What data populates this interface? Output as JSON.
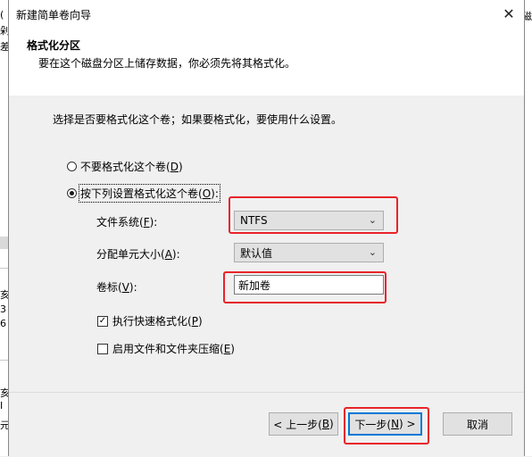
{
  "window": {
    "title": "新建简单卷向导",
    "close_glyph": "✕"
  },
  "header": {
    "title": "格式化分区",
    "subtitle": "要在这个磁盘分区上储存数据，你必须先将其格式化。"
  },
  "intro": "选择是否要格式化这个卷；如果要格式化，要使用什么设置。",
  "options": {
    "no_format": {
      "label": "不要格式化这个卷(",
      "key": "D",
      "close": ")",
      "checked": false
    },
    "format": {
      "label": "按下列设置格式化这个卷(",
      "key": "O",
      "close": "):",
      "checked": true
    }
  },
  "fields": {
    "filesystem": {
      "label": "文件系统(",
      "key": "F",
      "close": "):",
      "value": "NTFS"
    },
    "alloc_size": {
      "label": "分配单元大小(",
      "key": "A",
      "close": "):",
      "value": "默认值"
    },
    "volume_label": {
      "label": "卷标(",
      "key": "V",
      "close": "):",
      "value": "新加卷"
    }
  },
  "checks": {
    "quick_format": {
      "label": "执行快速格式化(",
      "key": "P",
      "close": ")",
      "checked": true
    },
    "compression": {
      "label": "启用文件和文件夹压缩(",
      "key": "E",
      "close": ")",
      "checked": false
    }
  },
  "buttons": {
    "back": {
      "prefix": "< 上一步(",
      "key": "B",
      "suffix": ")"
    },
    "next": {
      "prefix": "下一步(",
      "key": "N",
      "suffix": ") >"
    },
    "cancel": "取消"
  },
  "background": {
    "left_fragments": [
      "(",
      "剁",
      "差",
      "亥",
      "3",
      "6",
      "亥",
      "I",
      "元"
    ],
    "right_fragment": "磁"
  },
  "colors": {
    "highlight_red": "#e8232a",
    "focus_blue": "#0078d7",
    "dialog_bg": "#f0f0f0"
  }
}
